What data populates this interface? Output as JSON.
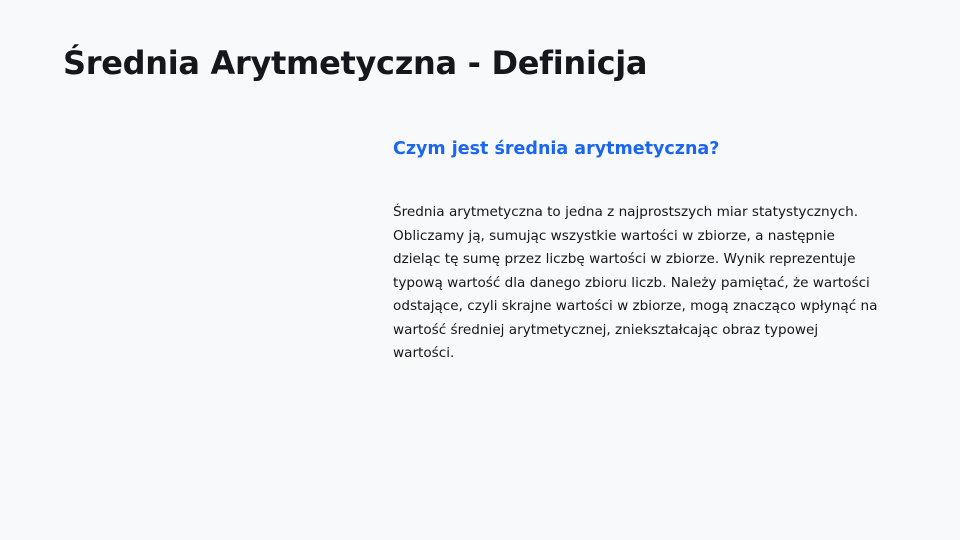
{
  "slide": {
    "title": "Średnia Arytmetyczna - Definicja",
    "subtitle": "Czym jest średnia arytmetyczna?",
    "paragraph_lines": [
      "Średnia arytmetyczna to jedna z najprostszych miar statystycznych.",
      "Obliczamy ją, sumując wszystkie wartości w zbiorze, a następnie",
      "dzieląc tę sumę przez liczbę wartości w zbiorze. Wynik reprezentuje",
      "typową wartość dla danego zbioru liczb. Należy pamiętać, że wartości",
      "odstające, czyli skrajne wartości w zbiorze, mogą znacząco wpłynąć na",
      "wartość średniej arytmetycznej, zniekształcając obraz typowej",
      "wartości."
    ]
  },
  "colors": {
    "accent": "#1a66f0",
    "background": "#f8f9fb",
    "text": "#16161d"
  }
}
